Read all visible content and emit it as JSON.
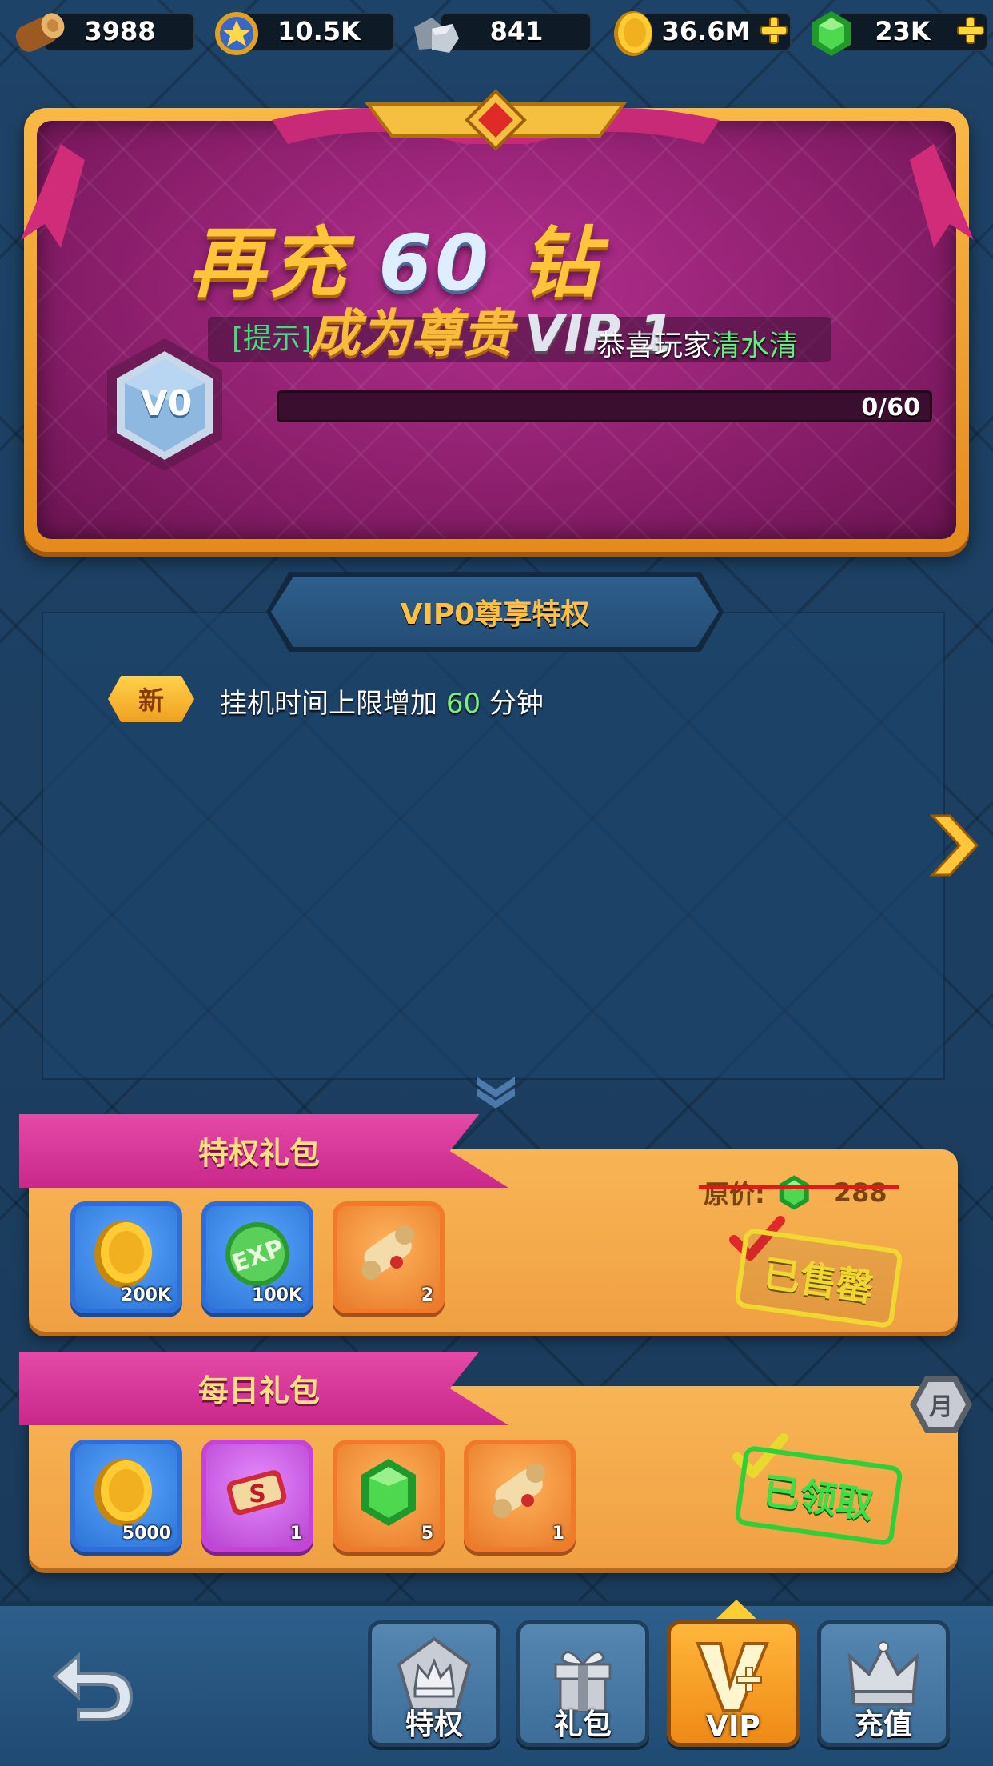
{
  "resources": [
    {
      "icon": "log-icon",
      "value": "3988"
    },
    {
      "icon": "star-medal-icon",
      "value": "10.5K"
    },
    {
      "icon": "iron-ore-icon",
      "value": "841"
    },
    {
      "icon": "gold-coin-icon",
      "value": "36.6M",
      "plus": true
    },
    {
      "icon": "green-gem-icon",
      "value": "23K",
      "plus": true
    }
  ],
  "banner": {
    "title_prefix": "再充",
    "title_amount": "60",
    "title_suffix": "钻",
    "subtitle": "成为尊贵",
    "subtitle_vip": "VIP 1",
    "ticker_tag": "[提示]",
    "ticker_msg": "恭喜玩家",
    "ticker_player": "清水清",
    "vip_level": "V0",
    "progress_text": "0/60",
    "progress_value": 0
  },
  "privileges": {
    "header": "VIP0尊享特权",
    "new_badge": "新",
    "line_prefix": "挂机时间上限增加 ",
    "line_value": "60",
    "line_suffix": " 分钟"
  },
  "packages": [
    {
      "title": "特权礼包",
      "original_price_label": "原价:",
      "original_price": "288",
      "stamp": "已售罄",
      "items": [
        {
          "icon": "gold-coin-icon",
          "count": "200K",
          "frame": "blue"
        },
        {
          "icon": "exp-orb-icon",
          "count": "100K",
          "frame": "blue"
        },
        {
          "icon": "scroll-icon",
          "count": "2",
          "frame": "orange"
        }
      ]
    },
    {
      "title": "每日礼包",
      "stamp": "已领取",
      "badge": "月",
      "items": [
        {
          "icon": "gold-coin-icon",
          "count": "5000",
          "frame": "blue"
        },
        {
          "icon": "magic-scroll-icon",
          "count": "1",
          "frame": "purple"
        },
        {
          "icon": "green-gem-icon",
          "count": "5",
          "frame": "orange"
        },
        {
          "icon": "scroll-icon",
          "count": "1",
          "frame": "orange"
        }
      ]
    }
  ],
  "nav": {
    "back_icon": "back-arrow-icon",
    "tabs": [
      {
        "label": "特权",
        "icon": "crown-pentagon-icon",
        "active": false
      },
      {
        "label": "礼包",
        "icon": "gift-box-icon",
        "active": false
      },
      {
        "label": "VIP",
        "icon": "vip-v-icon",
        "active": true
      },
      {
        "label": "充值",
        "icon": "crown-icon",
        "active": false
      }
    ]
  },
  "colors": {
    "accent_gold": "#ffc53a",
    "banner_purple": "#8a1e6b",
    "highlight_green": "#7cf07a",
    "tab_pink": "#d63597"
  }
}
